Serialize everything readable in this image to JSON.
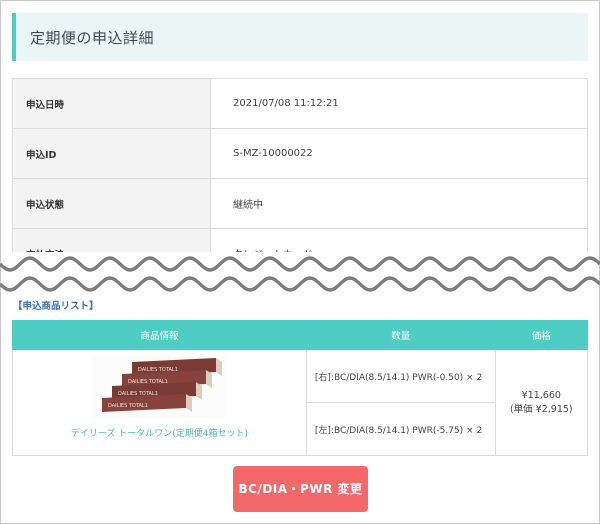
{
  "page_title": "定期便の申込詳細",
  "details": [
    {
      "label": "申込日時",
      "value": "2021/07/08 11:12:21"
    },
    {
      "label": "申込ID",
      "value": "S-MZ-10000022"
    },
    {
      "label": "申込状態",
      "value": "継続中"
    },
    {
      "label": "支払方法",
      "value": "クレジットカード"
    }
  ],
  "product_list_label": "【申込商品リスト】",
  "table": {
    "headers": [
      "商品情報",
      "数量",
      "価格"
    ],
    "product_name": "デイリーズ トータルワン(定期便4箱セット)",
    "product_image_text": "DAILIES TOTAL1",
    "options": [
      "[右]:BC/DIA(8.5/14.1) PWR(-0.50) × 2",
      "[左]:BC/DIA(8.5/14.1) PWR(-5.75) × 2"
    ],
    "price": "¥11,660",
    "unit_price": "(単価 ¥2,915)"
  },
  "button_label": "BC/DIA・PWR 変更",
  "colors": {
    "accent": "#4ecdc4",
    "button": "#f4686a",
    "title_bg": "#eaf6f5",
    "link": "#3a6fb0"
  }
}
